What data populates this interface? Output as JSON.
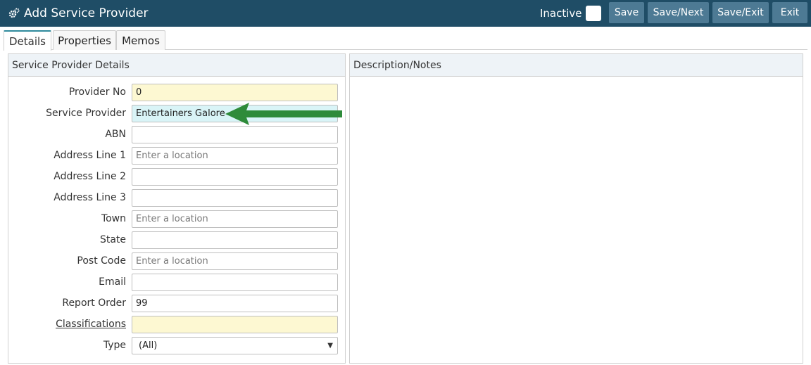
{
  "header": {
    "title": "Add Service Provider",
    "inactive_label": "Inactive",
    "buttons": {
      "save": "Save",
      "save_next": "Save/Next",
      "save_exit": "Save/Exit",
      "exit": "Exit"
    },
    "colors": {
      "bar": "#1f4d66",
      "button": "#4d7a94"
    }
  },
  "tabs": [
    {
      "label": "Details",
      "active": true
    },
    {
      "label": "Properties",
      "active": false
    },
    {
      "label": "Memos",
      "active": false
    }
  ],
  "details_panel": {
    "heading": "Service Provider Details",
    "fields": {
      "provider_no": {
        "label": "Provider No",
        "value": "0"
      },
      "service_provider": {
        "label": "Service Provider",
        "value": "Entertainers Galore"
      },
      "abn": {
        "label": "ABN",
        "value": ""
      },
      "address_line_1": {
        "label": "Address Line 1",
        "placeholder": "Enter a location"
      },
      "address_line_2": {
        "label": "Address Line 2",
        "value": ""
      },
      "address_line_3": {
        "label": "Address Line 3",
        "value": ""
      },
      "town": {
        "label": "Town",
        "placeholder": "Enter a location"
      },
      "state": {
        "label": "State",
        "value": ""
      },
      "post_code": {
        "label": "Post Code",
        "placeholder": "Enter a location"
      },
      "email": {
        "label": "Email",
        "value": ""
      },
      "report_order": {
        "label": "Report Order",
        "value": "99"
      },
      "classifications": {
        "label": "Classifications",
        "value": ""
      },
      "type": {
        "label": "Type",
        "value": "(All)"
      }
    }
  },
  "notes_panel": {
    "heading": "Description/Notes"
  },
  "annotation": {
    "arrow_color": "#2e8b3a",
    "icon": "gears-icon"
  }
}
